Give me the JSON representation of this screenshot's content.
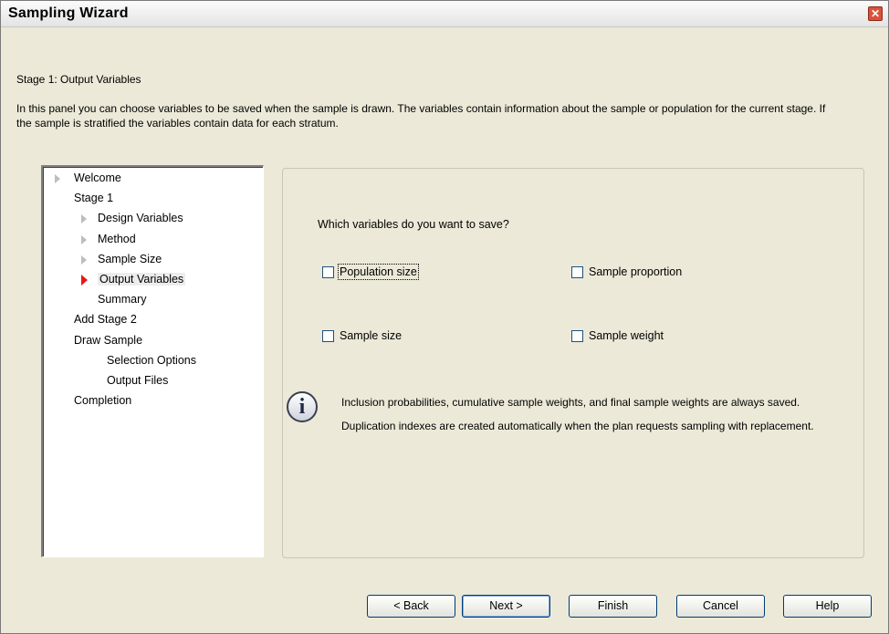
{
  "window": {
    "title": "Sampling Wizard",
    "close_label": "✕"
  },
  "header": {
    "stage_title": "Stage 1: Output Variables",
    "description": "In this panel you can choose variables to be saved when the sample is drawn. The variables contain information about the sample or population for the current stage. If the sample is stratified the variables contain data for each stratum."
  },
  "nav": {
    "items": [
      {
        "label": "Welcome",
        "level": 0,
        "arrow": "grey"
      },
      {
        "label": "Stage 1",
        "level": 0,
        "arrow": "none"
      },
      {
        "label": "Design Variables",
        "level": 1,
        "arrow": "grey"
      },
      {
        "label": "Method",
        "level": 1,
        "arrow": "grey"
      },
      {
        "label": "Sample Size",
        "level": 1,
        "arrow": "grey"
      },
      {
        "label": "Output Variables",
        "level": 1,
        "arrow": "red",
        "selected": true
      },
      {
        "label": "Summary",
        "level": 1,
        "arrow": "none"
      },
      {
        "label": "Add Stage 2",
        "level": 0,
        "arrow": "none"
      },
      {
        "label": "Draw Sample",
        "level": 0,
        "arrow": "none"
      },
      {
        "label": "Selection Options",
        "level": 2,
        "arrow": "none"
      },
      {
        "label": "Output Files",
        "level": 2,
        "arrow": "none"
      },
      {
        "label": "Completion",
        "level": 0,
        "arrow": "none"
      }
    ]
  },
  "content": {
    "question": "Which variables do you want to save?",
    "options": {
      "population_size": {
        "label": "Population size",
        "checked": false
      },
      "sample_proportion": {
        "label": "Sample proportion",
        "checked": false
      },
      "sample_size": {
        "label": "Sample size",
        "checked": false
      },
      "sample_weight": {
        "label": "Sample weight",
        "checked": false
      }
    },
    "info_icon": "info-icon",
    "info_paragraph_1": "Inclusion probabilities, cumulative sample weights, and final sample weights are always saved.",
    "info_paragraph_2": "Duplication indexes are created automatically when the plan requests sampling with replacement."
  },
  "buttons": {
    "back": "< Back",
    "next": "Next >",
    "finish": "Finish",
    "cancel": "Cancel",
    "help": "Help"
  },
  "colors": {
    "current_arrow": "#e81818",
    "collapsed_arrow": "#bdbdbd"
  }
}
